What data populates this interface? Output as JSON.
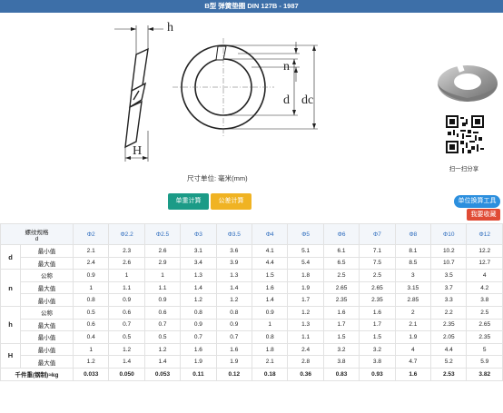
{
  "header": {
    "title": "B型 弹簧垫圈 DIN 127B - 1987"
  },
  "drawing": {
    "labels": {
      "h": "h",
      "H": "H",
      "n": "n",
      "d": "d",
      "dc": "dc"
    },
    "unit_note": "尺寸单位: 毫米(mm)"
  },
  "sidebar": {
    "share_caption": "扫一扫分享"
  },
  "buttons": {
    "weight_calc": "单重计算",
    "tolerance_calc": "公差计算",
    "unit_convert": "单位换算工具",
    "favorite": "我要收藏"
  },
  "table": {
    "corner_line1": "螺纹规格",
    "corner_line2": "d",
    "sizes": [
      "Φ2",
      "Φ2.2",
      "Φ2.5",
      "Φ3",
      "Φ3.5",
      "Φ4",
      "Φ5",
      "Φ6",
      "Φ7",
      "Φ8",
      "Φ10",
      "Φ12"
    ],
    "groups": [
      {
        "name": "d",
        "rows": [
          {
            "label": "最小值",
            "values": [
              "2.1",
              "2.3",
              "2.6",
              "3.1",
              "3.6",
              "4.1",
              "5.1",
              "6.1",
              "7.1",
              "8.1",
              "10.2",
              "12.2"
            ]
          },
          {
            "label": "最大值",
            "values": [
              "2.4",
              "2.6",
              "2.9",
              "3.4",
              "3.9",
              "4.4",
              "5.4",
              "6.5",
              "7.5",
              "8.5",
              "10.7",
              "12.7"
            ]
          }
        ]
      },
      {
        "name": "n",
        "rows": [
          {
            "label": "公称",
            "values": [
              "0.9",
              "1",
              "1",
              "1.3",
              "1.3",
              "1.5",
              "1.8",
              "2.5",
              "2.5",
              "3",
              "3.5",
              "4"
            ]
          },
          {
            "label": "最大值",
            "values": [
              "1",
              "1.1",
              "1.1",
              "1.4",
              "1.4",
              "1.6",
              "1.9",
              "2.65",
              "2.65",
              "3.15",
              "3.7",
              "4.2"
            ]
          },
          {
            "label": "最小值",
            "values": [
              "0.8",
              "0.9",
              "0.9",
              "1.2",
              "1.2",
              "1.4",
              "1.7",
              "2.35",
              "2.35",
              "2.85",
              "3.3",
              "3.8"
            ]
          }
        ]
      },
      {
        "name": "h",
        "rows": [
          {
            "label": "公称",
            "values": [
              "0.5",
              "0.6",
              "0.6",
              "0.8",
              "0.8",
              "0.9",
              "1.2",
              "1.6",
              "1.6",
              "2",
              "2.2",
              "2.5"
            ]
          },
          {
            "label": "最大值",
            "values": [
              "0.6",
              "0.7",
              "0.7",
              "0.9",
              "0.9",
              "1",
              "1.3",
              "1.7",
              "1.7",
              "2.1",
              "2.35",
              "2.65"
            ]
          },
          {
            "label": "最小值",
            "values": [
              "0.4",
              "0.5",
              "0.5",
              "0.7",
              "0.7",
              "0.8",
              "1.1",
              "1.5",
              "1.5",
              "1.9",
              "2.05",
              "2.35"
            ]
          }
        ]
      },
      {
        "name": "H",
        "rows": [
          {
            "label": "最小值",
            "values": [
              "1",
              "1.2",
              "1.2",
              "1.6",
              "1.6",
              "1.8",
              "2.4",
              "3.2",
              "3.2",
              "4",
              "4.4",
              "5"
            ]
          },
          {
            "label": "最大值",
            "values": [
              "1.2",
              "1.4",
              "1.4",
              "1.9",
              "1.9",
              "2.1",
              "2.8",
              "3.8",
              "3.8",
              "4.7",
              "5.2",
              "5.9"
            ]
          }
        ]
      }
    ],
    "weight_row": {
      "label": "千件重(钢制)≈kg",
      "values": [
        "0.033",
        "0.050",
        "0.053",
        "0.11",
        "0.12",
        "0.18",
        "0.36",
        "0.83",
        "0.93",
        "1.6",
        "2.53",
        "3.82"
      ]
    }
  },
  "colors": {
    "title_bar": "#3d6fa8",
    "weight_button": "#1b9b87",
    "tolerance_button": "#f0b323",
    "convert_button": "#2c8fde",
    "favorite_button": "#e04b35",
    "size_header_text": "#2c6bbd"
  }
}
